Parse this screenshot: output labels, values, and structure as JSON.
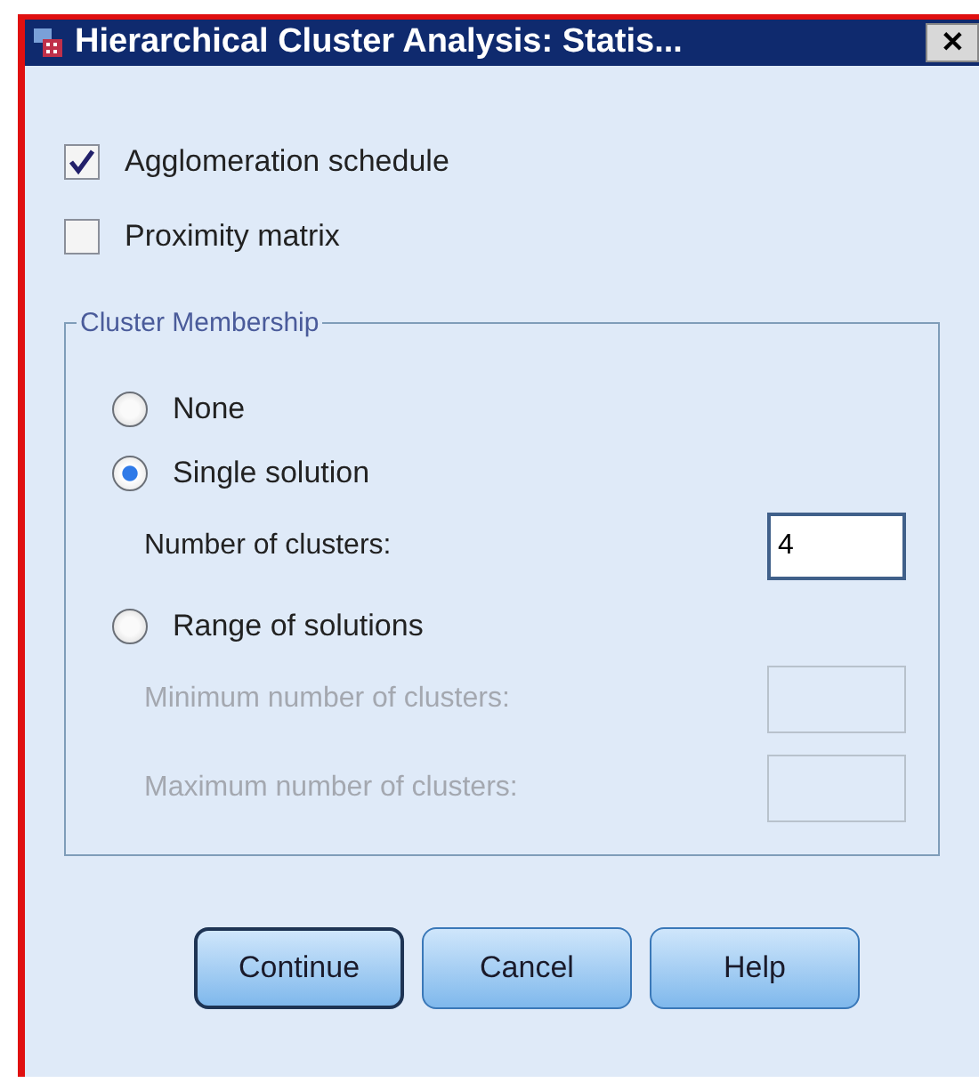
{
  "window": {
    "title": "Hierarchical Cluster Analysis: Statis...",
    "close": "✕"
  },
  "options": [
    {
      "label": "Agglomeration schedule",
      "checked": true
    },
    {
      "label": "Proximity matrix",
      "checked": false
    }
  ],
  "cluster_membership": {
    "title": "Cluster Membership",
    "items": [
      {
        "kind": "radio",
        "label": "None",
        "selected": false
      },
      {
        "kind": "radio",
        "label": "Single solution",
        "selected": true
      },
      {
        "kind": "field",
        "label": "Number of clusters:",
        "value": "4",
        "disabled": false
      },
      {
        "kind": "radio",
        "label": "Range of solutions",
        "selected": false
      },
      {
        "kind": "field",
        "label": "Minimum number of clusters:",
        "value": "",
        "disabled": true
      },
      {
        "kind": "field",
        "label": "Maximum number of clusters:",
        "value": "",
        "disabled": true
      }
    ]
  },
  "buttons": [
    {
      "label": "Continue",
      "default": true
    },
    {
      "label": "Cancel",
      "default": false
    },
    {
      "label": "Help",
      "default": false
    }
  ]
}
